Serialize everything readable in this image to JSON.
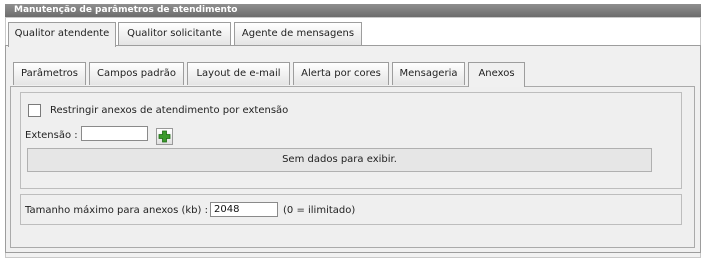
{
  "window": {
    "title": "Manutenção de parâmetros de atendimento"
  },
  "main_tabs": [
    {
      "label": "Qualitor atendente",
      "active": true
    },
    {
      "label": "Qualitor solicitante",
      "active": false
    },
    {
      "label": "Agente de mensagens",
      "active": false
    }
  ],
  "sub_tabs": [
    {
      "label": "Parâmetros",
      "active": false
    },
    {
      "label": "Campos padrão",
      "active": false
    },
    {
      "label": "Layout de e-mail",
      "active": false
    },
    {
      "label": "Alerta por cores",
      "active": false
    },
    {
      "label": "Mensageria",
      "active": false
    },
    {
      "label": "Anexos",
      "active": true
    }
  ],
  "restrict": {
    "checkbox_label": "Restringir anexos de atendimento por extensão",
    "checked": false,
    "extension_label": "Extensão :",
    "extension_value": "",
    "add_icon": "plus-icon",
    "empty_message": "Sem dados para exibir."
  },
  "max_size": {
    "label": "Tamanho máximo para anexos (kb) :",
    "value": "2048",
    "hint": "(0 = ilimitado)"
  },
  "colors": {
    "title_bar": "#7d7d7d",
    "panel_bg": "#f0f0f0",
    "add_icon": "#3b9a2c"
  }
}
